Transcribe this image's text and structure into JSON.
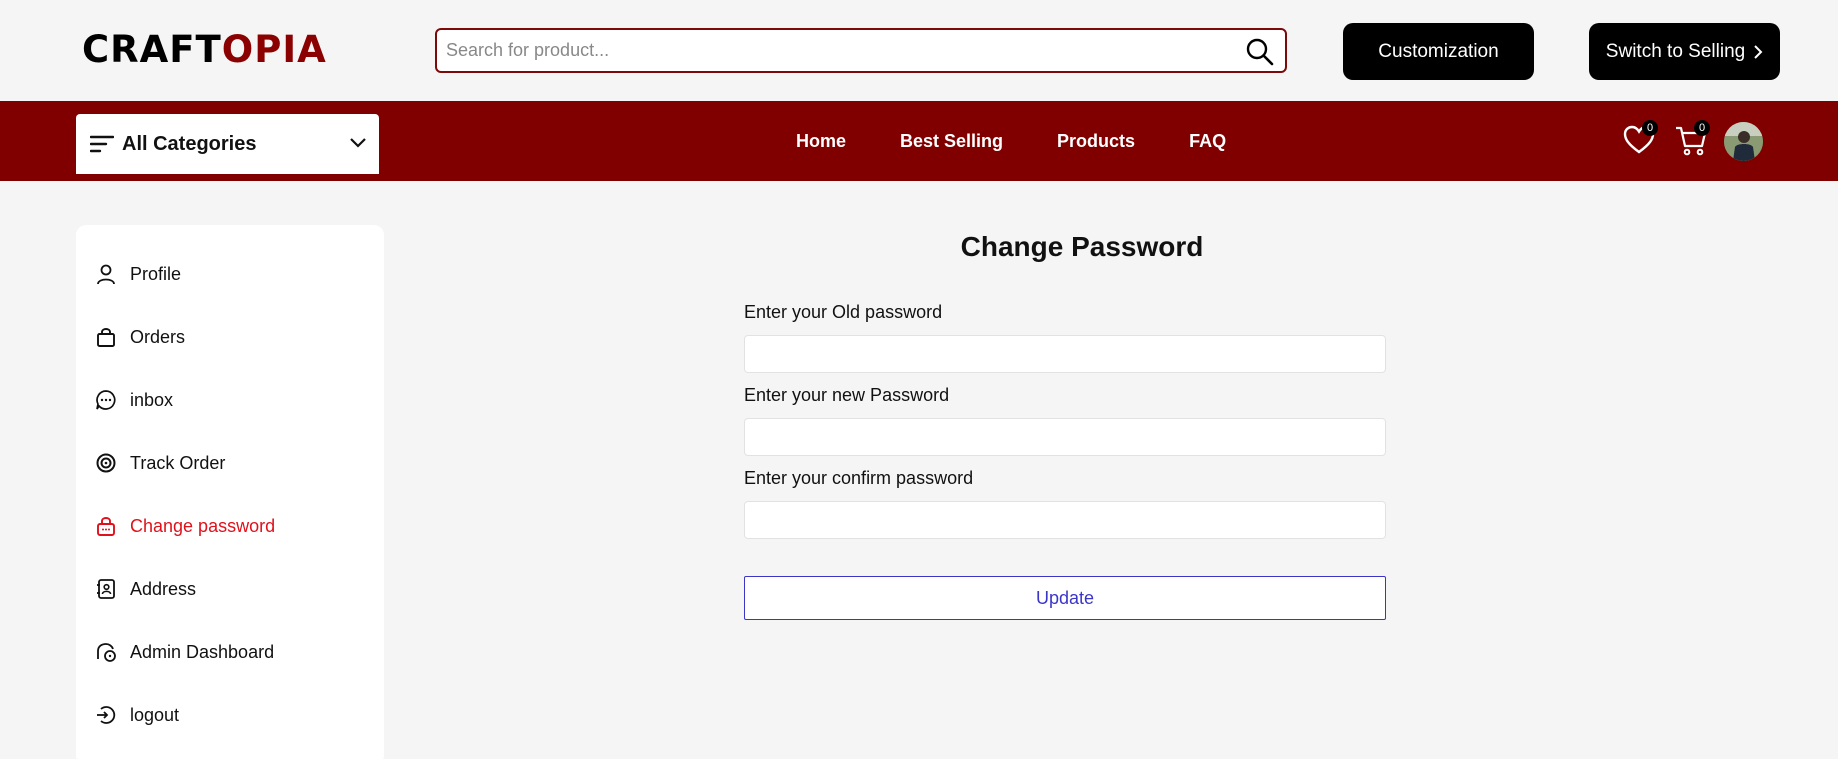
{
  "header": {
    "logo_part1": "CRAFT",
    "logo_part2": "OPIA",
    "search_placeholder": "Search for product...",
    "customization_label": "Customization",
    "switch_selling_label": "Switch to Selling"
  },
  "nav": {
    "categories_label": "All Categories",
    "links": [
      "Home",
      "Best Selling",
      "Products",
      "FAQ"
    ],
    "wishlist_count": "0",
    "cart_count": "0"
  },
  "sidebar": {
    "items": [
      {
        "label": "Profile",
        "icon": "user-icon"
      },
      {
        "label": "Orders",
        "icon": "bag-icon"
      },
      {
        "label": "inbox",
        "icon": "chat-icon"
      },
      {
        "label": "Track Order",
        "icon": "target-icon"
      },
      {
        "label": "Change password",
        "icon": "lock-icon",
        "active": true
      },
      {
        "label": "Address",
        "icon": "address-book-icon"
      },
      {
        "label": "Admin Dashboard",
        "icon": "dashboard-icon"
      },
      {
        "label": "logout",
        "icon": "logout-icon"
      }
    ]
  },
  "form": {
    "title": "Change Password",
    "old_label": "Enter your Old password",
    "new_label": "Enter your new Password",
    "confirm_label": "Enter your confirm password",
    "old_value": "",
    "new_value": "",
    "confirm_value": "",
    "submit_label": "Update"
  },
  "colors": {
    "brand_red": "#800000",
    "active_red": "#e0111b",
    "button_blue": "#3b35c9"
  }
}
